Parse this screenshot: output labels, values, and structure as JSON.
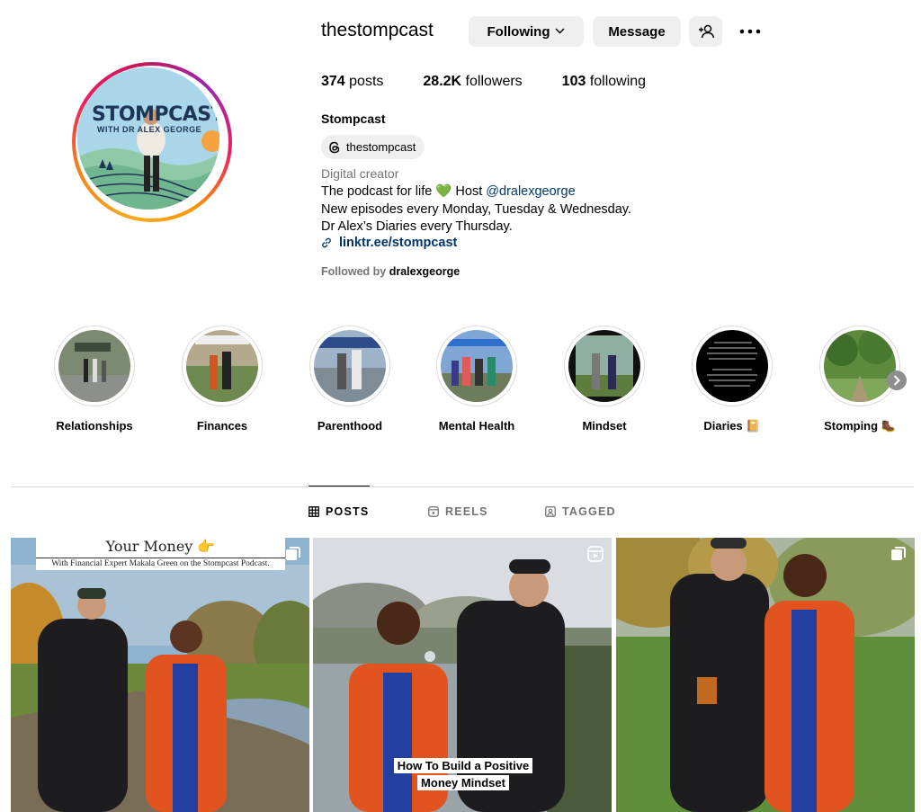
{
  "profile": {
    "username": "thestompcast",
    "full_name": "Stompcast",
    "threads_handle": "thestompcast",
    "category": "Digital creator",
    "bio_line1_prefix": "The podcast for life 💚 Host ",
    "bio_mention": "@dralexgeorge",
    "bio_line2": "New episodes every Monday, Tuesday & Wednesday.",
    "bio_line3": "Dr Alex’s Diaries every Thursday.",
    "link": "linktr.ee/stompcast",
    "followed_by_prefix": "Followed by ",
    "followed_by_user": "dralexgeorge",
    "avatar_text": "STOMPCAST",
    "avatar_sub": "WITH DR ALEX GEORGE"
  },
  "actions": {
    "following_label": "Following",
    "message_label": "Message",
    "add_user_icon": "add-user-icon",
    "more_icon": "more-icon"
  },
  "stats": {
    "posts_count": "374",
    "posts_label": " posts",
    "followers_count": "28.2K",
    "followers_label": " followers",
    "following_count": "103",
    "following_label": " following"
  },
  "highlights": [
    {
      "label": "Relationships"
    },
    {
      "label": "Finances"
    },
    {
      "label": "Parenthood"
    },
    {
      "label": "Mental Health"
    },
    {
      "label": "Mindset"
    },
    {
      "label": "Diaries 📔"
    },
    {
      "label": "Stomping 🥾"
    }
  ],
  "tabs": {
    "posts": "POSTS",
    "reels": "REELS",
    "tagged": "TAGGED"
  },
  "posts": [
    {
      "title": "Your Money 👉",
      "subtitle": "With Financial Expert Makala Green on the Stompcast Podcast.",
      "type_icon": "carousel-icon"
    },
    {
      "caption_line1": "How To Build a Positive",
      "caption_line2": "Money Mindset",
      "type_icon": "reel-icon"
    },
    {
      "type_icon": "carousel-icon"
    }
  ],
  "colors": {
    "link": "#00376b",
    "secondary_text": "#737373",
    "button_bg": "#efefef",
    "divider": "#dbdbdb"
  }
}
